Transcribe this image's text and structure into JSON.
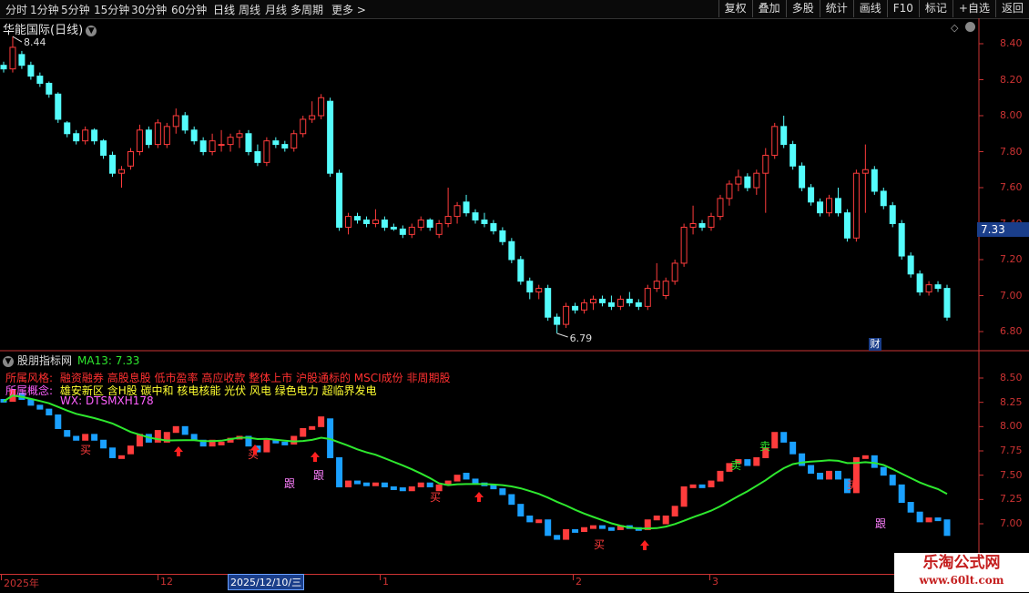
{
  "toolbar": {
    "left": [
      "分时",
      "1分钟",
      "5分钟",
      "15分钟",
      "30分钟",
      "60分钟",
      "日线",
      "周线",
      "月线",
      "多周期",
      "更多 >"
    ],
    "right": [
      "复权",
      "叠加",
      "多股",
      "统计",
      "画线",
      "F10",
      "标记",
      "+自选",
      "返回"
    ]
  },
  "main_chart": {
    "title": "华能国际(日线)",
    "high_label": "8.44",
    "low_label": "6.79",
    "axis": [
      "8.40",
      "8.20",
      "8.00",
      "7.80",
      "7.60",
      "7.40",
      "7.20",
      "7.00",
      "6.80"
    ],
    "current_price": "7.33",
    "cai_badge": "财"
  },
  "indicator": {
    "name": "股朋指标网",
    "ma_text": "MA13: 7.33",
    "style_label": "所属风格:",
    "style_value": "融资融券 高股息股 低市盈率 高应收款 整体上市 沪股通标的 MSCI成份 非周期股",
    "concept_label": "所属概念:",
    "concept_value": "雄安新区 含H股 碳中和 核电核能 光伏 风电 绿色电力 超临界发电",
    "wx": "WX: DTSMXH178",
    "axis": [
      "8.50",
      "8.25",
      "8.00",
      "7.75",
      "7.50",
      "7.25",
      "7.00"
    ],
    "signals": [
      {
        "text": "买",
        "type": "buy"
      },
      {
        "text": "买",
        "type": "buy"
      },
      {
        "text": "跟",
        "type": "follow"
      },
      {
        "text": "跟",
        "type": "follow"
      },
      {
        "text": "买",
        "type": "buy"
      },
      {
        "text": "买",
        "type": "buy"
      },
      {
        "text": "卖",
        "type": "sell"
      },
      {
        "text": "卖",
        "type": "sell"
      },
      {
        "text": "买",
        "type": "buy"
      },
      {
        "text": "跟",
        "type": "follow"
      }
    ]
  },
  "dates": {
    "labels": [
      "2025年",
      "12",
      "1",
      "2",
      "3"
    ],
    "selected": "2025/12/10/三"
  },
  "watermark": {
    "line1": "乐淘公式网",
    "line2": "www.60lt.com"
  },
  "colors": {
    "up": "#ff3c3c",
    "down": "#54fcfc",
    "ma": "#2ee82e",
    "axis": "#c33",
    "buy": "#ff3c3c",
    "sell": "#2ee82e",
    "follow": "#ff80ff",
    "arrow": "#ff2020"
  },
  "chart_data": {
    "type": "candlestick",
    "x_range": [
      "2025-11",
      "2026-03"
    ],
    "ylim": [
      6.7,
      8.5
    ],
    "series": [
      {
        "name": "K",
        "ohlc": [
          [
            8.28,
            8.3,
            8.24,
            8.26
          ],
          [
            8.26,
            8.44,
            8.24,
            8.38
          ],
          [
            8.34,
            8.36,
            8.26,
            8.28
          ],
          [
            8.28,
            8.3,
            8.2,
            8.22
          ],
          [
            8.22,
            8.24,
            8.16,
            8.18
          ],
          [
            8.18,
            8.19,
            8.1,
            8.12
          ],
          [
            8.12,
            8.13,
            7.96,
            7.98
          ],
          [
            7.96,
            7.97,
            7.88,
            7.9
          ],
          [
            7.9,
            7.92,
            7.84,
            7.86
          ],
          [
            7.86,
            7.94,
            7.84,
            7.92
          ],
          [
            7.92,
            7.93,
            7.84,
            7.86
          ],
          [
            7.86,
            7.87,
            7.76,
            7.78
          ],
          [
            7.78,
            7.8,
            7.66,
            7.68
          ],
          [
            7.68,
            7.72,
            7.6,
            7.7
          ],
          [
            7.72,
            7.82,
            7.7,
            7.8
          ],
          [
            7.8,
            7.95,
            7.78,
            7.92
          ],
          [
            7.92,
            7.94,
            7.82,
            7.84
          ],
          [
            7.84,
            7.98,
            7.82,
            7.96
          ],
          [
            7.84,
            7.96,
            7.82,
            7.94
          ],
          [
            7.94,
            8.04,
            7.9,
            8.0
          ],
          [
            8.0,
            8.02,
            7.9,
            7.92
          ],
          [
            7.92,
            7.94,
            7.84,
            7.86
          ],
          [
            7.86,
            7.88,
            7.78,
            7.8
          ],
          [
            7.8,
            7.9,
            7.78,
            7.86
          ],
          [
            7.84,
            7.92,
            7.8,
            7.84
          ],
          [
            7.84,
            7.9,
            7.8,
            7.88
          ],
          [
            7.88,
            7.92,
            7.82,
            7.9
          ],
          [
            7.9,
            7.92,
            7.78,
            7.8
          ],
          [
            7.8,
            7.84,
            7.72,
            7.74
          ],
          [
            7.74,
            7.88,
            7.72,
            7.86
          ],
          [
            7.86,
            7.88,
            7.82,
            7.84
          ],
          [
            7.84,
            7.86,
            7.8,
            7.82
          ],
          [
            7.82,
            7.92,
            7.8,
            7.9
          ],
          [
            7.9,
            8.0,
            7.88,
            7.98
          ],
          [
            7.98,
            8.08,
            7.96,
            8.0
          ],
          [
            8.0,
            8.12,
            7.98,
            8.1
          ],
          [
            8.08,
            8.1,
            7.66,
            7.68
          ],
          [
            7.68,
            7.7,
            7.36,
            7.38
          ],
          [
            7.38,
            7.46,
            7.34,
            7.44
          ],
          [
            7.44,
            7.46,
            7.4,
            7.42
          ],
          [
            7.42,
            7.44,
            7.38,
            7.4
          ],
          [
            7.4,
            7.48,
            7.38,
            7.42
          ],
          [
            7.42,
            7.44,
            7.36,
            7.38
          ],
          [
            7.38,
            7.4,
            7.36,
            7.37
          ],
          [
            7.37,
            7.39,
            7.32,
            7.34
          ],
          [
            7.34,
            7.4,
            7.32,
            7.38
          ],
          [
            7.38,
            7.44,
            7.36,
            7.42
          ],
          [
            7.42,
            7.43,
            7.36,
            7.38
          ],
          [
            7.34,
            7.42,
            7.32,
            7.4
          ],
          [
            7.4,
            7.6,
            7.38,
            7.44
          ],
          [
            7.44,
            7.52,
            7.4,
            7.5
          ],
          [
            7.52,
            7.56,
            7.44,
            7.46
          ],
          [
            7.46,
            7.48,
            7.4,
            7.42
          ],
          [
            7.42,
            7.46,
            7.38,
            7.4
          ],
          [
            7.4,
            7.42,
            7.34,
            7.36
          ],
          [
            7.36,
            7.38,
            7.28,
            7.3
          ],
          [
            7.3,
            7.32,
            7.18,
            7.2
          ],
          [
            7.2,
            7.22,
            7.06,
            7.08
          ],
          [
            7.08,
            7.1,
            6.98,
            7.02
          ],
          [
            7.02,
            7.06,
            6.98,
            7.04
          ],
          [
            7.04,
            7.06,
            6.86,
            6.88
          ],
          [
            6.88,
            6.9,
            6.79,
            6.84
          ],
          [
            6.84,
            6.96,
            6.82,
            6.94
          ],
          [
            6.94,
            6.96,
            6.9,
            6.92
          ],
          [
            6.92,
            6.98,
            6.9,
            6.96
          ],
          [
            6.96,
            7.0,
            6.92,
            6.98
          ],
          [
            6.98,
            7.0,
            6.94,
            6.96
          ],
          [
            6.96,
            7.0,
            6.92,
            6.94
          ],
          [
            6.94,
            7.0,
            6.92,
            6.98
          ],
          [
            6.98,
            7.02,
            6.94,
            6.96
          ],
          [
            6.96,
            6.98,
            6.92,
            6.94
          ],
          [
            6.94,
            7.06,
            6.92,
            7.04
          ],
          [
            7.04,
            7.18,
            7.02,
            7.08
          ],
          [
            7.0,
            7.1,
            6.98,
            7.08
          ],
          [
            7.08,
            7.2,
            7.06,
            7.18
          ],
          [
            7.18,
            7.4,
            7.16,
            7.38
          ],
          [
            7.38,
            7.5,
            7.34,
            7.4
          ],
          [
            7.4,
            7.42,
            7.36,
            7.38
          ],
          [
            7.38,
            7.46,
            7.36,
            7.44
          ],
          [
            7.44,
            7.56,
            7.42,
            7.54
          ],
          [
            7.54,
            7.64,
            7.5,
            7.62
          ],
          [
            7.62,
            7.7,
            7.58,
            7.66
          ],
          [
            7.66,
            7.68,
            7.58,
            7.6
          ],
          [
            7.6,
            7.7,
            7.56,
            7.68
          ],
          [
            7.68,
            7.82,
            7.46,
            7.78
          ],
          [
            7.78,
            7.96,
            7.76,
            7.94
          ],
          [
            7.94,
            8.0,
            7.82,
            7.84
          ],
          [
            7.84,
            7.86,
            7.7,
            7.72
          ],
          [
            7.72,
            7.74,
            7.58,
            7.6
          ],
          [
            7.6,
            7.62,
            7.5,
            7.52
          ],
          [
            7.52,
            7.54,
            7.44,
            7.46
          ],
          [
            7.46,
            7.56,
            7.44,
            7.54
          ],
          [
            7.54,
            7.6,
            7.44,
            7.46
          ],
          [
            7.46,
            7.48,
            7.3,
            7.32
          ],
          [
            7.32,
            7.7,
            7.3,
            7.68
          ],
          [
            7.68,
            7.84,
            7.46,
            7.7
          ],
          [
            7.7,
            7.72,
            7.56,
            7.58
          ],
          [
            7.58,
            7.6,
            7.48,
            7.5
          ],
          [
            7.5,
            7.52,
            7.38,
            7.4
          ],
          [
            7.4,
            7.42,
            7.2,
            7.22
          ],
          [
            7.22,
            7.24,
            7.1,
            7.12
          ],
          [
            7.12,
            7.14,
            7.0,
            7.02
          ],
          [
            7.02,
            7.08,
            7.0,
            7.06
          ],
          [
            7.06,
            7.08,
            7.02,
            7.04
          ],
          [
            7.04,
            7.06,
            6.86,
            6.88
          ]
        ]
      },
      {
        "name": "MA13",
        "values_start": "indicator"
      }
    ]
  }
}
